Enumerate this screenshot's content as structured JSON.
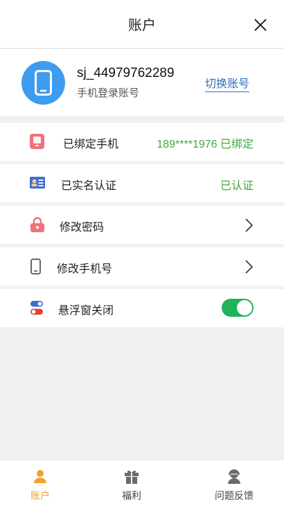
{
  "header": {
    "title": "账户"
  },
  "profile": {
    "username": "sj_44979762289",
    "login_type": "手机登录账号",
    "switch_label": "切换账号",
    "avatar_icon": "phone-icon",
    "avatar_color": "#3e9cf0"
  },
  "settings": {
    "phone_bind": {
      "label": "已绑定手机",
      "value": "189****1976 已绑定",
      "icon": "phone-card-icon"
    },
    "realname": {
      "label": "已实名认证",
      "value": "已认证",
      "icon": "id-card-icon"
    },
    "password": {
      "label": "修改密码",
      "icon": "lock-icon"
    },
    "change_phone": {
      "label": "修改手机号",
      "icon": "mobile-phone-icon"
    },
    "float_window": {
      "label": "悬浮窗关闭",
      "icon": "toggle-settings-icon",
      "enabled": true
    }
  },
  "tabbar": {
    "items": [
      {
        "label": "账户",
        "icon": "person-icon",
        "active": true
      },
      {
        "label": "福利",
        "icon": "gift-icon",
        "active": false
      },
      {
        "label": "问题反馈",
        "icon": "support-agent-icon",
        "active": false
      }
    ]
  },
  "colors": {
    "accent_green": "#3eaa3a",
    "link_blue": "#2e6fb8",
    "tab_active": "#f0a22e",
    "toggle_on": "#20b35a"
  }
}
